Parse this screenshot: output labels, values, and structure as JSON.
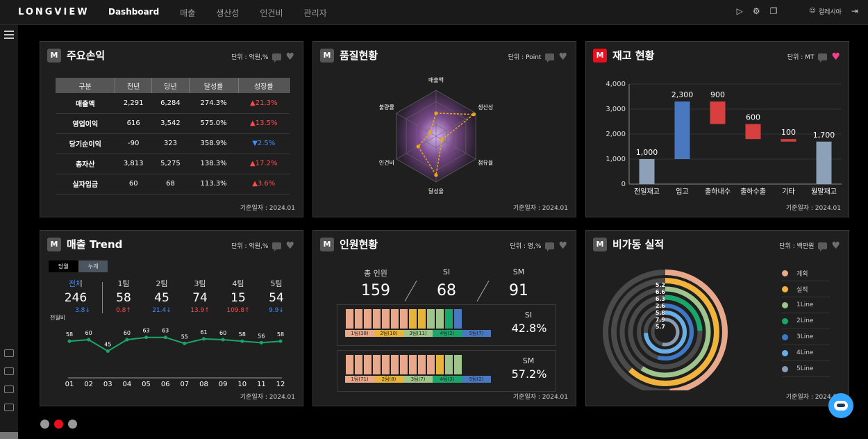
{
  "app": {
    "logo": "LONGVIEW",
    "nav": [
      "Dashboard",
      "매출",
      "생산성",
      "인건비",
      "관리자"
    ],
    "user_name": "컬레시아"
  },
  "pl": {
    "title": "주요손익",
    "unit": "단위 : 억원,%",
    "date": "기준일자 : 2024.01",
    "headers": [
      "구분",
      "전년",
      "당년",
      "달성률",
      "성장률"
    ],
    "rows": [
      [
        "매출액",
        "2,291",
        "6,284",
        "274.3%",
        "▲21.3%"
      ],
      [
        "영업이익",
        "616",
        "3,542",
        "575.0%",
        "▲13.5%"
      ],
      [
        "당기순이익",
        "-90",
        "323",
        "358.9%",
        "▼2.5%"
      ],
      [
        "총자산",
        "3,813",
        "5,275",
        "138.3%",
        "▲17.2%"
      ],
      [
        "실자입금",
        "60",
        "68",
        "113.3%",
        "▲3.6%"
      ]
    ]
  },
  "quality": {
    "title": "품질현황",
    "unit": "단위 : Point",
    "date": "기준일자 : 2024.01",
    "axes": [
      "매출액",
      "생산성",
      "점유율",
      "달성율",
      "인건비",
      "불량률"
    ]
  },
  "inventory": {
    "title": "재고 현황",
    "unit": "단위 : MT",
    "date": "기준일자 : 2024.01"
  },
  "trend": {
    "title": "매출 Trend",
    "unit": "단위 : 억원,%",
    "date": "기준일자 : 2024.01",
    "toggle": [
      "당월",
      "누계"
    ],
    "prev_label": "전월비",
    "teams": [
      {
        "name": "전체",
        "value": "246",
        "pct": "3.8↓"
      },
      {
        "name": "1팀",
        "value": "58",
        "pct": "0.8↑"
      },
      {
        "name": "2팀",
        "value": "45",
        "pct": "21.4↓"
      },
      {
        "name": "3팀",
        "value": "74",
        "pct": "13.9↑"
      },
      {
        "name": "4팀",
        "value": "15",
        "pct": "109.8↑"
      },
      {
        "name": "5팀",
        "value": "54",
        "pct": "9.9↓"
      }
    ]
  },
  "staff": {
    "title": "인원현황",
    "unit": "단위 : 명,%",
    "date": "기준일자 : 2024.01",
    "total_label": "총 인원",
    "total": "159",
    "si_label": "SI",
    "si": "68",
    "sm_label": "SM",
    "sm": "91",
    "si_pct": "42.8%",
    "sm_pct": "57.2%",
    "si_teams": [
      "1팀(38)",
      "2팀(10)",
      "3팀(11)",
      "4팀(2)",
      "5팀(7)"
    ],
    "sm_teams": [
      "1팀(71)",
      "2팀(8)",
      "3팀(7)",
      "4팀(3)",
      "5팀(2)"
    ]
  },
  "downtime": {
    "title": "비가동 실적",
    "unit": "단위 : 백만원",
    "date": "기준일자 : 2024.01",
    "legend": [
      {
        "label": "계획",
        "color": "#e8a88c"
      },
      {
        "label": "실적",
        "color": "#f0b43c"
      },
      {
        "label": "1Line",
        "color": "#9fc48c"
      },
      {
        "label": "2Line",
        "color": "#1aa56a"
      },
      {
        "label": "3Line",
        "color": "#3e78c4"
      },
      {
        "label": "4Line",
        "color": "#6aaee6"
      },
      {
        "label": "5Line",
        "color": "#8a9cb4"
      }
    ]
  },
  "chart_data": [
    {
      "type": "table",
      "title": "주요손익",
      "columns": [
        "구분",
        "전년",
        "당년",
        "달성률",
        "성장률"
      ],
      "rows": [
        [
          "매출액",
          2291,
          6284,
          274.3,
          21.3
        ],
        [
          "영업이익",
          616,
          3542,
          575.0,
          13.5
        ],
        [
          "당기순이익",
          -90,
          323,
          358.9,
          -2.5
        ],
        [
          "총자산",
          3813,
          5275,
          138.3,
          17.2
        ],
        [
          "실자입금",
          60,
          68,
          113.3,
          3.6
        ]
      ]
    },
    {
      "type": "radar",
      "title": "품질현황",
      "categories": [
        "매출액",
        "생산성",
        "점유율",
        "달성율",
        "인건비",
        "불량률"
      ],
      "series": [
        {
          "values": [
            0.5,
            0.95,
            0.15,
            0.85,
            0.45,
            0.15
          ]
        }
      ],
      "max": 1
    },
    {
      "type": "bar",
      "title": "재고 현황",
      "subtype": "waterfall",
      "categories": [
        "전일재고",
        "입고",
        "출하내수",
        "출하수출",
        "기타",
        "월말재고"
      ],
      "values": [
        1000,
        2300,
        -900,
        -600,
        -100,
        1700
      ],
      "labels": [
        "1,000",
        "2,300",
        "900",
        "600",
        "100",
        "1,700"
      ],
      "yticks": [
        "0",
        "1,000",
        "2,000",
        "3,000",
        "4,000"
      ],
      "ylim": [
        0,
        4000
      ]
    },
    {
      "type": "line",
      "title": "매출 Trend",
      "categories": [
        "01",
        "02",
        "03",
        "04",
        "05",
        "06",
        "07",
        "08",
        "09",
        "10",
        "11",
        "12"
      ],
      "values": [
        58,
        60,
        45,
        60,
        63,
        63,
        55,
        61,
        60,
        58,
        56,
        58
      ]
    },
    {
      "type": "radial-bar",
      "title": "비가동 실적",
      "categories": [
        "계획",
        "실적",
        "1Line",
        "2Line",
        "3Line",
        "4Line",
        "5Line"
      ],
      "values": [
        5.2,
        6.6,
        6.3,
        2.6,
        5.8,
        7.9,
        5.7
      ],
      "labels": [
        "5.2",
        "6.6",
        "6.3",
        "2.6",
        "5.8",
        "7.9",
        "5.7"
      ],
      "max": 8
    }
  ]
}
